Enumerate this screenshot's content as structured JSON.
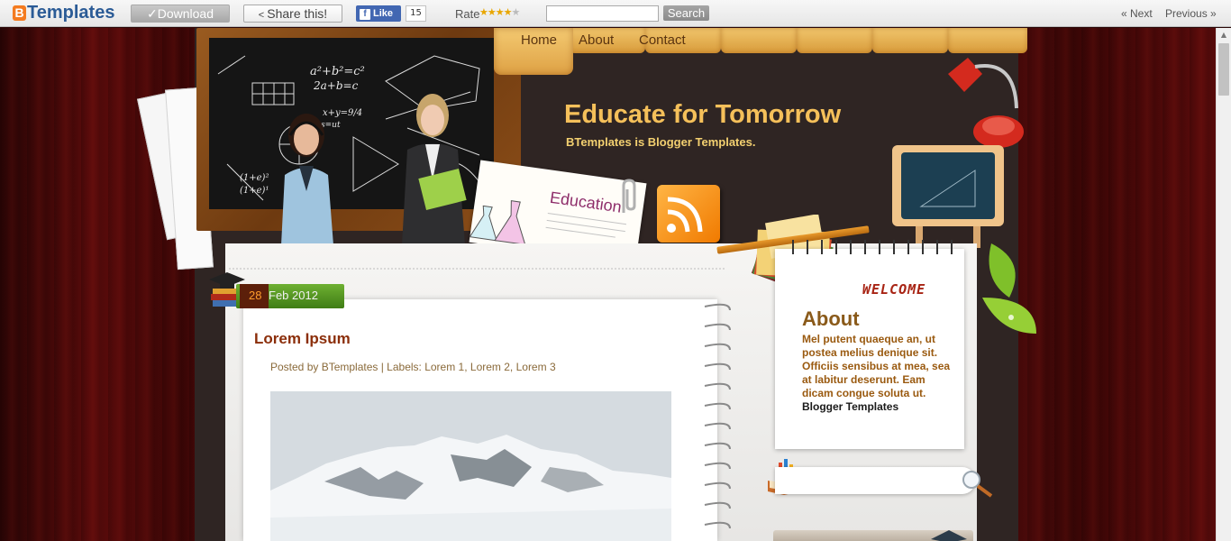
{
  "topbar": {
    "logo_text": "Templates",
    "logo_b": "B",
    "download_label": "Download",
    "share_label": "Share this!",
    "fb_like_label": "Like",
    "fb_like_count": "15",
    "rate_label": "Rate",
    "rating": 4,
    "rating_max": 5,
    "search_placeholder": "",
    "search_button": "Search",
    "prev_label": "« Next",
    "next_label": "Previous »"
  },
  "nav": {
    "items": [
      {
        "label": "Home"
      },
      {
        "label": "About"
      },
      {
        "label": "Contact"
      }
    ]
  },
  "header": {
    "title": "Educate for Tomorrow",
    "description": "BTemplates is Blogger Templates.",
    "card_text": "Education"
  },
  "chalkboard": {
    "lines": [
      "a²+b²=c²",
      "2a+b=c",
      "x+y=9/4",
      "s=ut",
      "(1+e)²",
      "(1+e)¹"
    ]
  },
  "post": {
    "day": "28",
    "month_year": "Feb 2012",
    "title": "Lorem Ipsum",
    "meta": "Posted by BTemplates | Labels: Lorem 1, Lorem 2, Lorem 3"
  },
  "sidebar": {
    "welcome": "WELCOME",
    "about_title": "About",
    "about_body": "Mel putent quaeque an, ut postea melius denique sit. Officiis sensibus at mea, sea at labitur deserunt. Eam dicam congue soluta ut.",
    "about_link": "Blogger Templates"
  },
  "colors": {
    "title": "#f5c05a",
    "accent_green": "#4f8f1f",
    "post_title": "#8b2e0a",
    "brand_blue": "#2b5b96"
  }
}
